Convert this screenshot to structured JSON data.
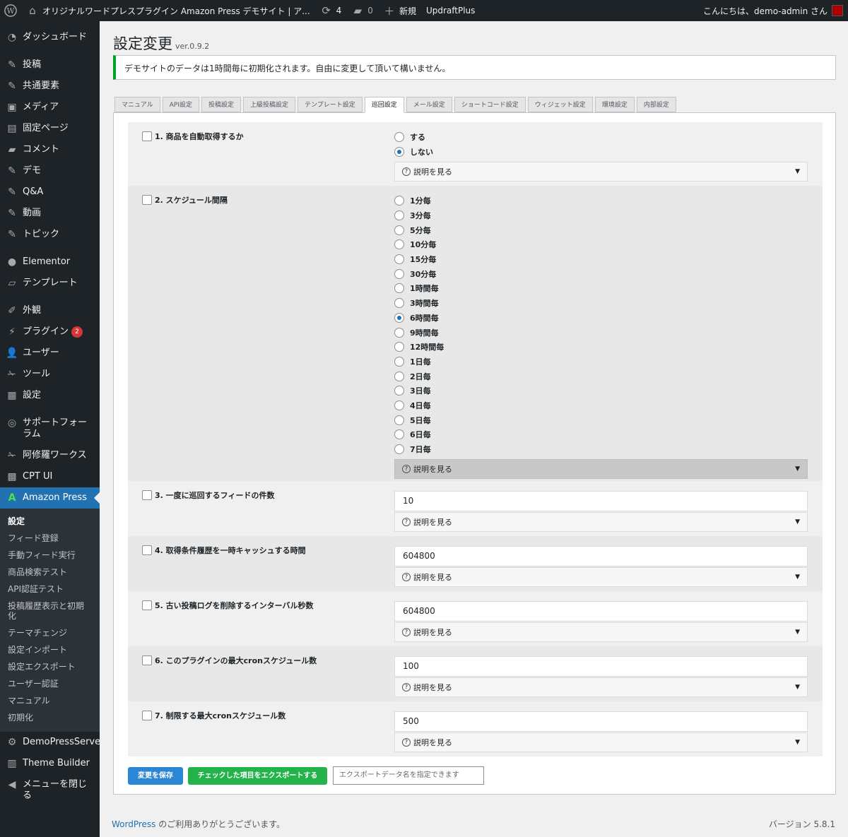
{
  "adminbar": {
    "site_name": "オリジナルワードプレスプラグイン Amazon Press デモサイト | ア...",
    "updates_count": "4",
    "comments_count": "0",
    "new_label": "新規",
    "updraft_label": "UpdraftPlus",
    "greeting": "こんにちは、demo-admin さん"
  },
  "menu": {
    "items": [
      {
        "label": "ダッシュボード",
        "icon": "dashboard-icon"
      },
      {
        "label": "投稿",
        "icon": "pin-icon"
      },
      {
        "label": "共通要素",
        "icon": "pin-icon"
      },
      {
        "label": "メディア",
        "icon": "media-icon"
      },
      {
        "label": "固定ページ",
        "icon": "page-icon"
      },
      {
        "label": "コメント",
        "icon": "comment-icon"
      },
      {
        "label": "デモ",
        "icon": "pin-icon"
      },
      {
        "label": "Q&A",
        "icon": "pin-icon"
      },
      {
        "label": "動画",
        "icon": "pin-icon"
      },
      {
        "label": "トピック",
        "icon": "pin-icon"
      },
      {
        "label": "Elementor",
        "icon": "elementor-icon"
      },
      {
        "label": "テンプレート",
        "icon": "folder-icon"
      },
      {
        "label": "外観",
        "icon": "brush-icon"
      },
      {
        "label": "プラグイン",
        "icon": "plugin-icon",
        "badge": "2"
      },
      {
        "label": "ユーザー",
        "icon": "user-icon"
      },
      {
        "label": "ツール",
        "icon": "wrench-icon"
      },
      {
        "label": "設定",
        "icon": "settings-icon"
      },
      {
        "label": "サポートフォーラム",
        "icon": "support-icon"
      },
      {
        "label": "阿修羅ワークス",
        "icon": "wrench-icon"
      },
      {
        "label": "CPT UI",
        "icon": "grid-icon"
      },
      {
        "label": "Amazon Press",
        "icon": "amazon-press-icon"
      }
    ],
    "submenu": [
      "設定",
      "フィード登録",
      "手動フィード実行",
      "商品検索テスト",
      "API認証テスト",
      "投稿履歴表示と初期化",
      "テーマチェンジ",
      "設定インポート",
      "設定エクスポート",
      "ユーザー認証",
      "マニュアル",
      "初期化"
    ],
    "bottom": [
      {
        "label": "DemoPressServer",
        "icon": "server-icon"
      },
      {
        "label": "Theme Builder",
        "icon": "theme-builder-icon"
      },
      {
        "label": "メニューを閉じる",
        "icon": "collapse-icon"
      }
    ]
  },
  "page": {
    "title": "設定変更",
    "version": "ver.0.9.2",
    "notice": "デモサイトのデータは1時間毎に初期化されます。自由に変更して頂いて構いません。"
  },
  "tabs": [
    "マニュアル",
    "API設定",
    "投稿設定",
    "上級投稿設定",
    "テンプレート設定",
    "巡回設定",
    "メール設定",
    "ショートコード設定",
    "ウィジェット設定",
    "環境設定",
    "内部設定"
  ],
  "active_tab": "巡回設定",
  "settings": {
    "s1": {
      "label": "1. 商品を自動取得するか",
      "options": [
        "する",
        "しない"
      ],
      "selected": "しない"
    },
    "s2": {
      "label": "2. スケジュール間隔",
      "options": [
        "1分毎",
        "3分毎",
        "5分毎",
        "10分毎",
        "15分毎",
        "30分毎",
        "1時間毎",
        "3時間毎",
        "6時間毎",
        "9時間毎",
        "12時間毎",
        "1日毎",
        "2日毎",
        "3日毎",
        "4日毎",
        "5日毎",
        "6日毎",
        "7日毎"
      ],
      "selected": "6時間毎"
    },
    "s3": {
      "label": "3. 一度に巡回するフィードの件数",
      "value": "10"
    },
    "s4": {
      "label": "4. 取得条件履歴を一時キャッシュする時間",
      "value": "604800"
    },
    "s5": {
      "label": "5. 古い投稿ログを削除するインターバル秒数",
      "value": "604800"
    },
    "s6": {
      "label": "6. このプラグインの最大cronスケジュール数",
      "value": "100"
    },
    "s7": {
      "label": "7. 制限する最大cronスケジュール数",
      "value": "500"
    }
  },
  "details_label": "説明を見る",
  "buttons": {
    "save": "変更を保存",
    "export": "チェックした項目をエクスポートする",
    "export_placeholder": "エクスポートデータ名を指定できます"
  },
  "footer": {
    "wp_link": "WordPress",
    "thanks": " のご利用ありがとうございます。",
    "version": "バージョン 5.8.1"
  }
}
